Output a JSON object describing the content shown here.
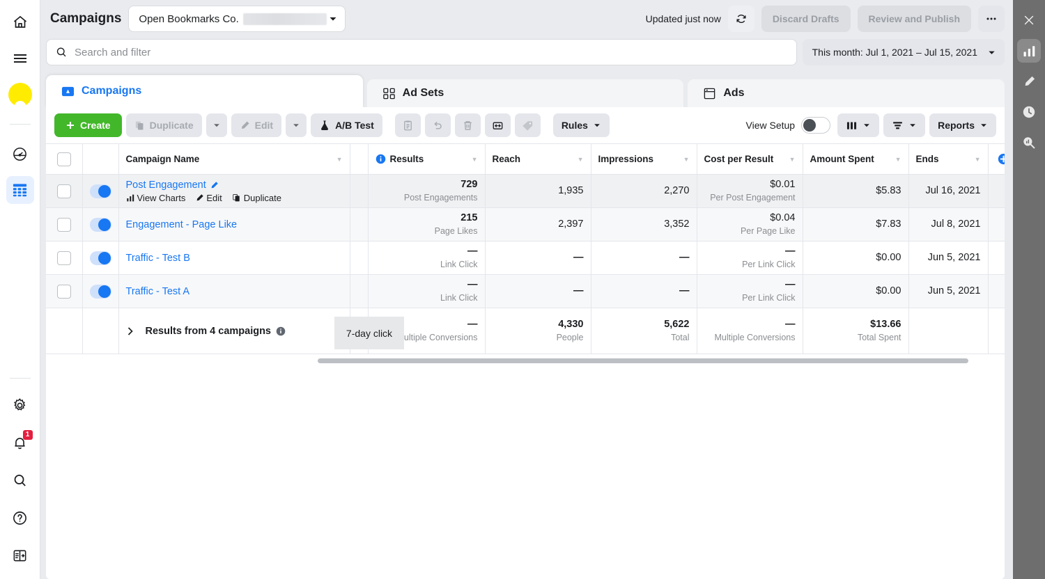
{
  "left_rail": {
    "items": [
      {
        "name": "home-icon",
        "label": "Home"
      },
      {
        "name": "menu-icon",
        "label": "All Tools"
      },
      {
        "name": "business-logo",
        "label": "Business"
      },
      {
        "name": "gauge-icon",
        "label": "Account Overview"
      },
      {
        "name": "table-icon",
        "label": "Ads Manager"
      }
    ],
    "bottom_items": [
      {
        "name": "gear-icon",
        "label": "Settings"
      },
      {
        "name": "bell-icon",
        "label": "Notifications",
        "badge": "1"
      },
      {
        "name": "search-icon",
        "label": "Search"
      },
      {
        "name": "help-icon",
        "label": "Help"
      },
      {
        "name": "panel-toggle-icon",
        "label": "Collapse panel"
      }
    ]
  },
  "right_rail": {
    "items": [
      {
        "name": "close-icon",
        "label": "Close"
      },
      {
        "name": "bar-chart-icon",
        "label": "Charts",
        "active": true
      },
      {
        "name": "pencil-icon",
        "label": "Edit"
      },
      {
        "name": "clock-icon",
        "label": "Activity History"
      },
      {
        "name": "chart-search-icon",
        "label": "Inspect"
      }
    ]
  },
  "header": {
    "title": "Campaigns",
    "account": "Open Bookmarks Co.",
    "account_redacted": true,
    "updated_text": "Updated just now",
    "refresh_label": "Refresh",
    "discard_drafts": "Discard Drafts",
    "review_publish": "Review and Publish",
    "more_label": "..."
  },
  "search": {
    "placeholder": "Search and filter",
    "value": "",
    "date_range": "This month: Jul 1, 2021 – Jul 15, 2021"
  },
  "tabs": [
    {
      "label": "Campaigns",
      "icon": "campaigns-icon",
      "active": true
    },
    {
      "label": "Ad Sets",
      "icon": "adsets-icon",
      "active": false
    },
    {
      "label": "Ads",
      "icon": "ads-icon",
      "active": false
    }
  ],
  "toolbar": {
    "create": "Create",
    "duplicate": "Duplicate",
    "edit": "Edit",
    "ab_test": "A/B Test",
    "rules": "Rules",
    "view_setup": "View Setup",
    "view_setup_on": false,
    "reports": "Reports",
    "icons": [
      {
        "name": "clipboard-icon",
        "label": "Clipboard"
      },
      {
        "name": "undo-icon",
        "label": "Undo"
      },
      {
        "name": "trash-icon",
        "label": "Delete"
      },
      {
        "name": "export-icon",
        "label": "Export"
      },
      {
        "name": "tag-icon",
        "label": "Tags"
      }
    ],
    "columns_label": "Columns",
    "breakdown_label": "Breakdown"
  },
  "table": {
    "columns": [
      {
        "key": "name",
        "label": "Campaign Name"
      },
      {
        "key": "results",
        "label": "Results",
        "info": true
      },
      {
        "key": "reach",
        "label": "Reach"
      },
      {
        "key": "impressions",
        "label": "Impressions"
      },
      {
        "key": "cpr",
        "label": "Cost per Result"
      },
      {
        "key": "spent",
        "label": "Amount Spent"
      },
      {
        "key": "ends",
        "label": "Ends"
      }
    ],
    "attribution_chip": "7-day click",
    "rows": [
      {
        "name": "Post Engagement",
        "hovered": true,
        "toggle_on": true,
        "actions": [
          "View Charts",
          "Edit",
          "Duplicate"
        ],
        "results": "729",
        "results_sub": "Post Engagements",
        "reach": "1,935",
        "impressions": "2,270",
        "cpr": "$0.01",
        "cpr_sub": "Per Post Engagement",
        "spent": "$5.83",
        "ends": "Jul 16, 2021"
      },
      {
        "name": "Engagement - Page Like",
        "hovered": false,
        "toggle_on": true,
        "actions": [],
        "results": "215",
        "results_sub": "Page Likes",
        "reach": "2,397",
        "impressions": "3,352",
        "cpr": "$0.04",
        "cpr_sub": "Per Page Like",
        "spent": "$7.83",
        "ends": "Jul 8, 2021"
      },
      {
        "name": "Traffic - Test B",
        "hovered": false,
        "toggle_on": true,
        "actions": [],
        "results": "—",
        "results_sub": "Link Click",
        "reach": "—",
        "impressions": "—",
        "cpr": "—",
        "cpr_sub": "Per Link Click",
        "spent": "$0.00",
        "ends": "Jun 5, 2021"
      },
      {
        "name": "Traffic - Test A",
        "hovered": false,
        "toggle_on": true,
        "actions": [],
        "results": "—",
        "results_sub": "Link Click",
        "reach": "—",
        "impressions": "—",
        "cpr": "—",
        "cpr_sub": "Per Link Click",
        "spent": "$0.00",
        "ends": "Jun 5, 2021"
      }
    ],
    "summary": {
      "label": "Results from 4 campaigns",
      "results": "—",
      "results_sub": "Multiple Conversions",
      "reach": "4,330",
      "reach_sub": "People",
      "impressions": "5,622",
      "impressions_sub": "Total",
      "cpr": "—",
      "cpr_sub": "Multiple Conversions",
      "spent": "$13.66",
      "spent_sub": "Total Spent",
      "ends": ""
    }
  }
}
